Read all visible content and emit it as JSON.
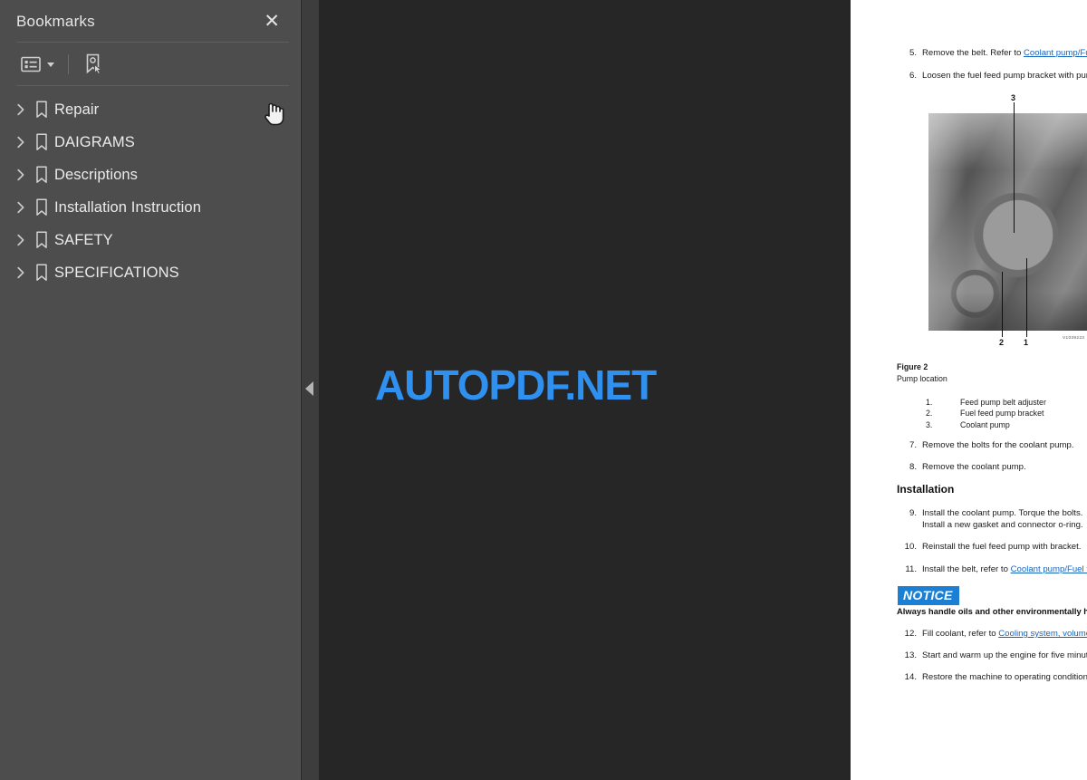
{
  "sidebar": {
    "title": "Bookmarks",
    "close_label": "✕",
    "toolbar": {
      "options_icon": "list-options-icon",
      "new_bookmark_icon": "new-bookmark-icon"
    },
    "items": [
      {
        "label": "Repair",
        "expanded": false
      },
      {
        "label": "DAIGRAMS",
        "expanded": false
      },
      {
        "label": "Descriptions",
        "expanded": false
      },
      {
        "label": "Installation Instruction",
        "expanded": false
      },
      {
        "label": "SAFETY",
        "expanded": false
      },
      {
        "label": "SPECIFICATIONS",
        "expanded": false
      }
    ]
  },
  "viewer": {
    "collapse_handle_icon": "triangle-left-icon",
    "watermark": "AUTOPDF.NET",
    "watermark_color": "#2f90f0"
  },
  "document": {
    "steps_top": [
      {
        "num": "5.",
        "text_before": "Remove the belt. Refer to ",
        "link": "Coolant pump/Fuel feed pump belt, replacing",
        "text_after": ""
      },
      {
        "num": "6.",
        "text_before": "Loosen the fuel feed pump bracket with pump from the coolant pump.",
        "link": "",
        "text_after": ""
      }
    ],
    "figure": {
      "caption_title": "Figure 2",
      "caption_subtitle": "Pump location",
      "image_id": "V1039223",
      "callouts": [
        {
          "num": "3",
          "position": "top"
        },
        {
          "num": "2",
          "position": "bottom-left"
        },
        {
          "num": "1",
          "position": "bottom-right"
        }
      ],
      "legend": [
        {
          "num": "1.",
          "label": "Feed pump belt adjuster"
        },
        {
          "num": "2.",
          "label": "Fuel feed pump bracket"
        },
        {
          "num": "3.",
          "label": "Coolant pump"
        }
      ]
    },
    "steps_mid": [
      {
        "num": "7.",
        "text_before": "Remove the bolts for the coolant pump.",
        "link": "",
        "text_after": ""
      },
      {
        "num": "8.",
        "text_before": "Remove the coolant pump.",
        "link": "",
        "text_after": ""
      }
    ],
    "section_heading": "Installation",
    "steps_install": [
      {
        "num": "9.",
        "text_before": "Install the coolant pump. Torque the bolts.",
        "line2": "Install a new gasket and connector o-ring.",
        "link": "",
        "text_after": ""
      },
      {
        "num": "10.",
        "text_before": "Reinstall the fuel feed pump with bracket.",
        "link": "",
        "text_after": ""
      },
      {
        "num": "11.",
        "text_before": "Install the belt, refer to ",
        "link": "Coolant pump/Fuel feed pump belt, replacing",
        "text_after": ""
      }
    ],
    "notice": {
      "tag": "NOTICE",
      "tag_color": "#1b7fd4",
      "text": "Always handle oils and other environmentally hazardous fluids in an environmentally safe manner."
    },
    "steps_end": [
      {
        "num": "12.",
        "text_before": "Fill coolant, refer to ",
        "link": "Cooling system, volume",
        "text_after": ""
      },
      {
        "num": "13.",
        "text_before": "Start and warm up the engine for five minutes. Check that there are no leaks.",
        "link": "",
        "text_after": ""
      },
      {
        "num": "14.",
        "text_before": "Restore the machine to operating condition.",
        "link": "",
        "text_after": ""
      }
    ]
  }
}
